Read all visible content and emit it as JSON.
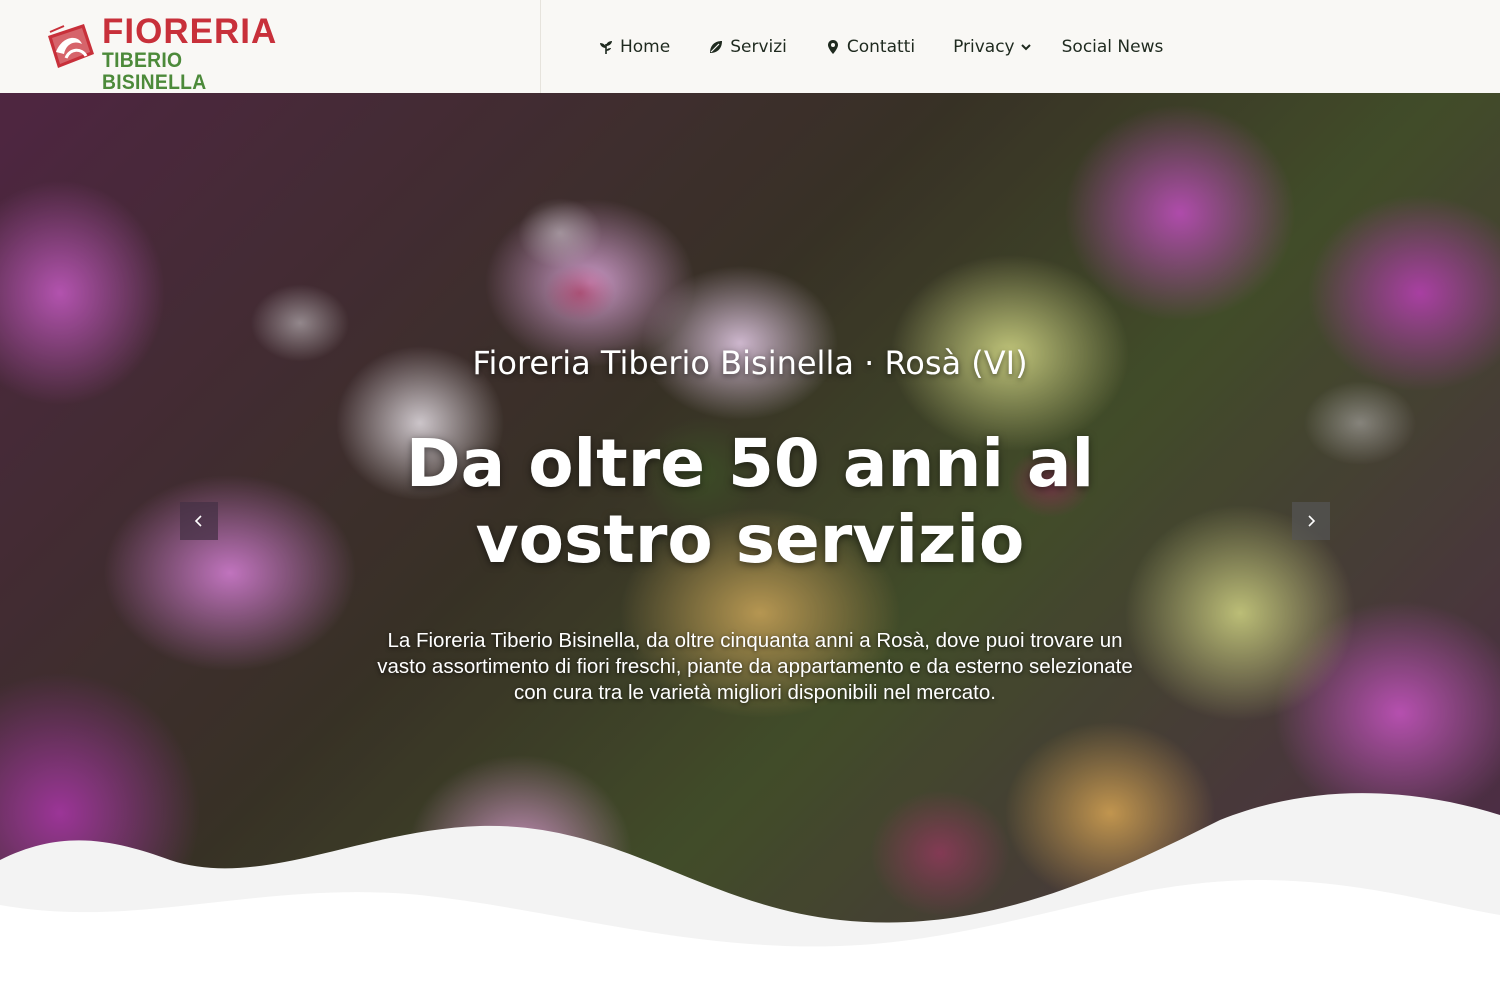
{
  "brand": {
    "name_line1": "FIORERIA",
    "name_line2": "TIBERIO BISINELLA",
    "colors": {
      "red": "#c8303a",
      "green": "#4c8a3a"
    }
  },
  "nav": {
    "items": [
      {
        "label": "Home",
        "icon": "plant-icon"
      },
      {
        "label": "Servizi",
        "icon": "leaf-icon"
      },
      {
        "label": "Contatti",
        "icon": "map-marker-icon"
      },
      {
        "label": "Privacy",
        "icon": "chevron-down-icon"
      },
      {
        "label": "Social News"
      }
    ]
  },
  "hero": {
    "kicker": "Fioreria Tiberio Bisinella · Rosà (VI)",
    "title": "Da oltre 50 anni al vostro servizio",
    "text": "La Fioreria Tiberio Bisinella, da oltre cinquanta anni a Rosà, dove puoi trovare un vasto assortimento di fiori freschi, piante da appartamento e da esterno selezionate con cura tra le varietà migliori disponibili nel mercato.",
    "prev_icon": "chevron-left-icon",
    "next_icon": "chevron-right-icon"
  }
}
